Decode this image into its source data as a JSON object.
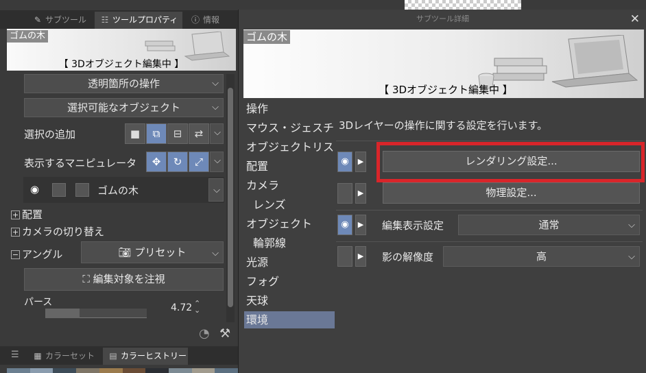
{
  "left_panel": {
    "tabs": [
      {
        "label": "サブツール",
        "icon": "brush-icon"
      },
      {
        "label": "ツールプロパティ",
        "icon": "sliders-icon"
      },
      {
        "label": "情報",
        "icon": "info-icon"
      }
    ],
    "thumb": {
      "name": "ゴムの木",
      "status": "【 3Dオブジェクト編集中 】"
    },
    "dropdown_transparent": "透明箇所の操作",
    "dropdown_selectable": "選択可能なオブジェクト",
    "add_selection_label": "選択の追加",
    "manipulator_label": "表示するマニピュレータ",
    "layer_name": "ゴムの木",
    "section_placement": "配置",
    "section_camera_switch": "カメラの切り替え",
    "section_angle": "アングル",
    "preset_label": "プリセット",
    "focus_button": "編集対象を注視",
    "perspective_label": "パース",
    "perspective_value": "4.72",
    "bottom_tabs": [
      {
        "label": "カラーセット",
        "icon": "palette-icon"
      },
      {
        "label": "カラーヒストリー",
        "icon": "film-icon"
      }
    ],
    "swatch_colors": [
      "#6b7f90",
      "#8a9cae",
      "#3d4c58",
      "#7e7566",
      "#9b7b4d",
      "#6a4c35",
      "#2b2e33",
      "#7c8a93",
      "#a19b8e",
      "#5b6f80"
    ]
  },
  "dialog": {
    "title": "サブツール詳細",
    "close_glyph": "✕",
    "thumb_name": "ゴムの木",
    "thumb_status": "【 3Dオブジェクト編集中 】",
    "categories": [
      {
        "label": "操作",
        "indent": false,
        "selected": false
      },
      {
        "label": "マウス・ジェスチャー",
        "indent": false,
        "selected": false
      },
      {
        "label": "オブジェクトリスト",
        "indent": false,
        "selected": false
      },
      {
        "label": "配置",
        "indent": false,
        "selected": false
      },
      {
        "label": "カメラ",
        "indent": false,
        "selected": false
      },
      {
        "label": "レンズ",
        "indent": true,
        "selected": false
      },
      {
        "label": "オブジェクト",
        "indent": false,
        "selected": false
      },
      {
        "label": "輪郭線",
        "indent": true,
        "selected": false
      },
      {
        "label": "光源",
        "indent": false,
        "selected": false
      },
      {
        "label": "フォグ",
        "indent": false,
        "selected": false
      },
      {
        "label": "天球",
        "indent": false,
        "selected": false
      },
      {
        "label": "環境",
        "indent": false,
        "selected": true
      }
    ],
    "description": "3Dレイヤーの操作に関する設定を行います。",
    "rendering_button": "レンダリング設定...",
    "physics_button": "物理設定...",
    "edit_display_label": "編集表示設定",
    "edit_display_value": "通常",
    "shadow_label": "影の解像度",
    "shadow_value": "高"
  },
  "colors": {
    "highlight": "#d9252a",
    "selected_category": "#6a7896",
    "toggle_on": "#6e89b8"
  }
}
